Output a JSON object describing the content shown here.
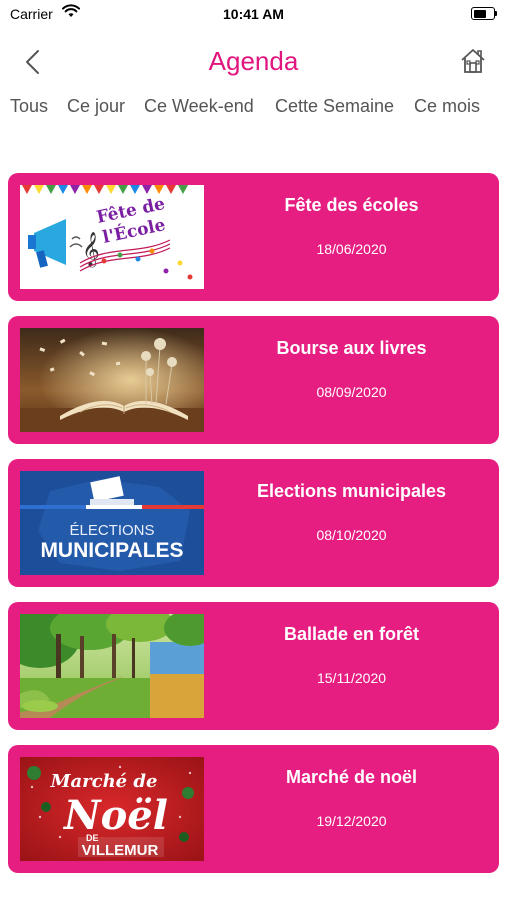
{
  "status_bar": {
    "carrier": "Carrier",
    "time": "10:41 AM"
  },
  "nav": {
    "title": "Agenda",
    "back_icon": "chevron-left-icon",
    "home_icon": "home-icon"
  },
  "filters": [
    "Tous",
    "Ce jour",
    "Ce Week-end",
    "Cette Semaine",
    "Ce mois"
  ],
  "colors": {
    "accent": "#e2157f",
    "card": "#e61e82"
  },
  "events": [
    {
      "title": "Fête des écoles",
      "date": "18/06/2020",
      "image": {
        "lettering": [
          "Fête de",
          "l'École"
        ]
      }
    },
    {
      "title": "Bourse aux livres",
      "date": "08/09/2020"
    },
    {
      "title": "Elections municipales",
      "date": "08/10/2020",
      "image": {
        "lettering": [
          "ÉLECTIONS",
          "MUNICIPALES"
        ]
      }
    },
    {
      "title": "Ballade en forêt",
      "date": "15/11/2020"
    },
    {
      "title": "Marché de noël",
      "date": "19/12/2020",
      "image": {
        "lettering": [
          "Marché de",
          "Noël",
          "DE",
          "VILLEMUR"
        ]
      }
    }
  ]
}
